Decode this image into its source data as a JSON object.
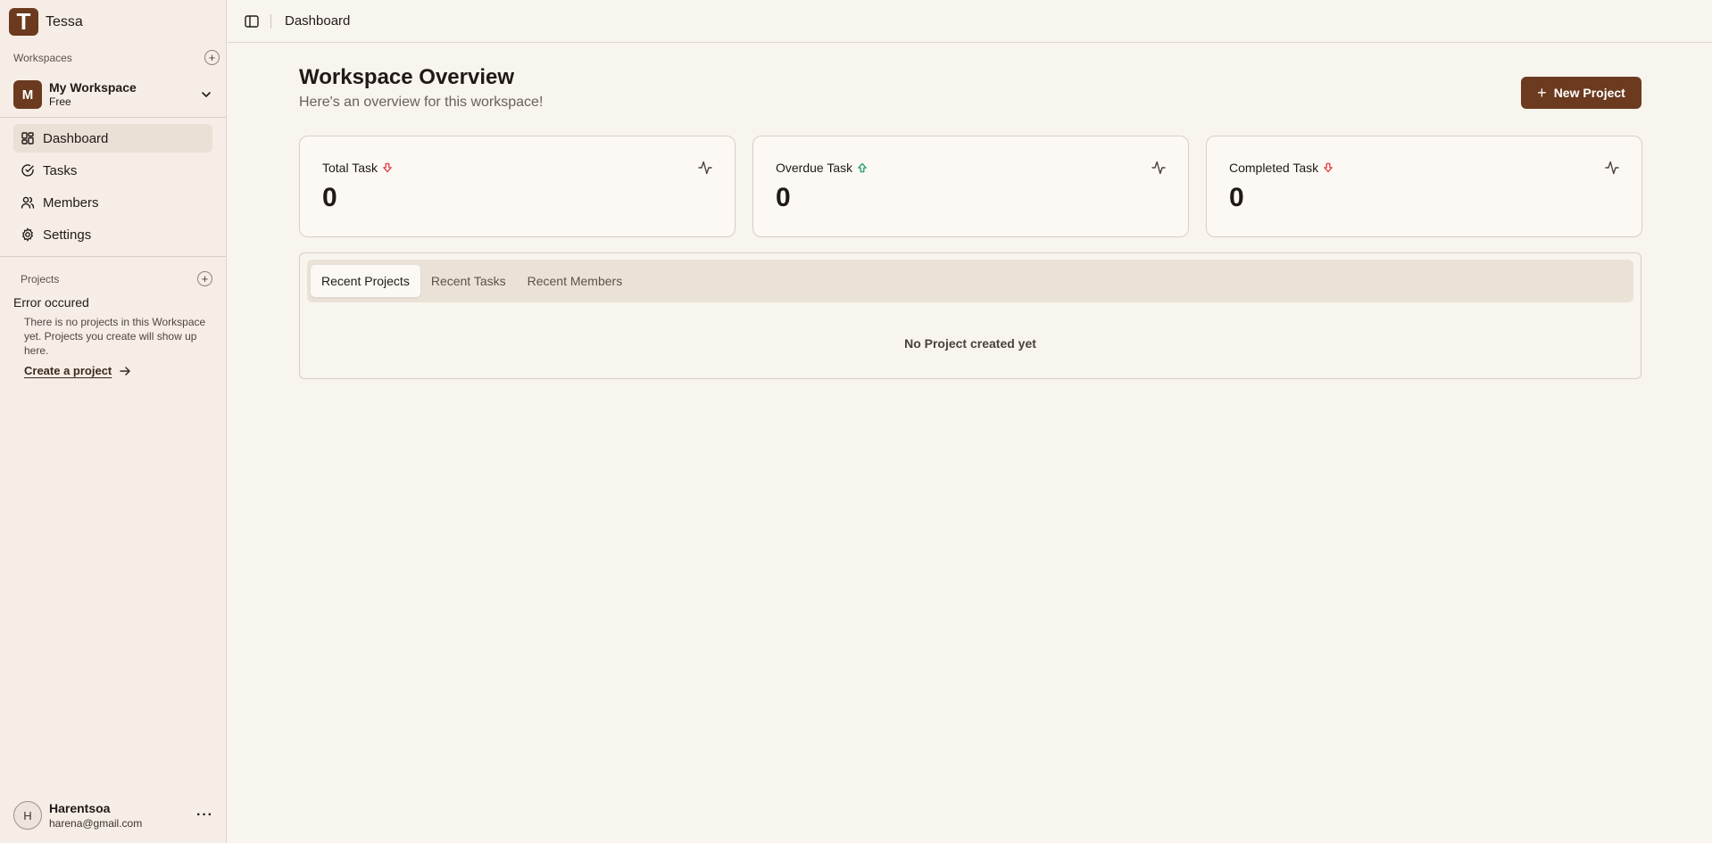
{
  "app": {
    "name": "Tessa",
    "logo_letter": "T"
  },
  "sidebar": {
    "workspaces_label": "Workspaces",
    "workspace": {
      "initial": "M",
      "name": "My Workspace",
      "plan": "Free"
    },
    "nav": [
      {
        "label": "Dashboard",
        "icon": "dashboard-icon",
        "active": true
      },
      {
        "label": "Tasks",
        "icon": "check-circle-icon",
        "active": false
      },
      {
        "label": "Members",
        "icon": "users-icon",
        "active": false
      },
      {
        "label": "Settings",
        "icon": "gear-icon",
        "active": false
      }
    ],
    "projects_label": "Projects",
    "projects_error": {
      "title": "Error occured",
      "description": "There is no projects in this Workspace yet. Projects you create will show up here.",
      "link": "Create a project"
    },
    "user": {
      "initial": "H",
      "name": "Harentsoa",
      "email": "harena@gmail.com"
    }
  },
  "topbar": {
    "breadcrumb": "Dashboard"
  },
  "main": {
    "title": "Workspace Overview",
    "subtitle": "Here's an overview for this workspace!",
    "new_project_label": "New Project",
    "stats": [
      {
        "label": "Total Task",
        "value": "0",
        "trend": "down",
        "trend_color": "#e5484d"
      },
      {
        "label": "Overdue Task",
        "value": "0",
        "trend": "up",
        "trend_color": "#30a46c"
      },
      {
        "label": "Completed Task",
        "value": "0",
        "trend": "down",
        "trend_color": "#e5484d"
      }
    ],
    "tabs": [
      {
        "label": "Recent Projects",
        "active": true
      },
      {
        "label": "Recent Tasks",
        "active": false
      },
      {
        "label": "Recent Members",
        "active": false
      }
    ],
    "empty_message": "No Project created yet"
  },
  "colors": {
    "brand": "#6b3a1f",
    "background": "#f8f4ee",
    "sidebar": "#f5ede6"
  }
}
